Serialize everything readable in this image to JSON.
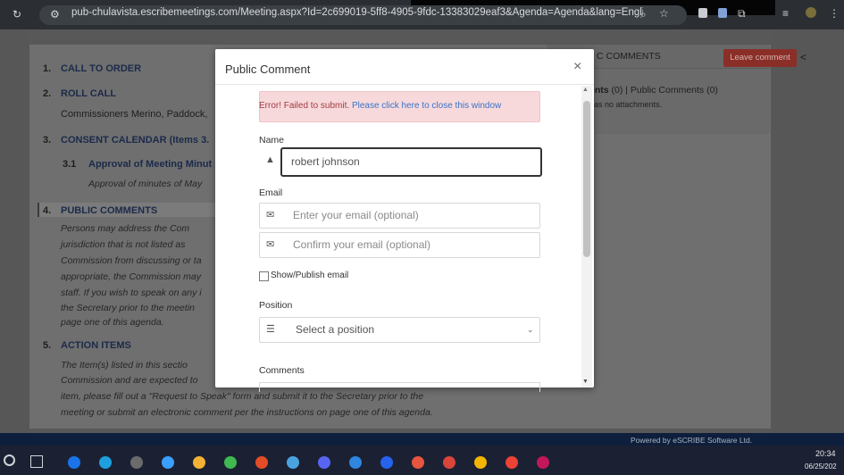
{
  "browser": {
    "url": "pub-chulavista.escribemeetings.com/Meeting.aspx?Id=2c699019-5ff8-4905-9fdc-13383029eaf3&Agenda=Agenda&lang=Englis...",
    "icons": [
      "reload-icon",
      "site-settings-icon",
      "zoom-icon",
      "star-icon",
      "extension-icon",
      "puzzle-icon",
      "reading-list-icon",
      "profile-icon",
      "menu-icon"
    ]
  },
  "agenda": {
    "items": [
      {
        "num": "1.",
        "label": "CALL TO ORDER"
      },
      {
        "num": "2.",
        "label": "ROLL CALL"
      },
      {
        "num": "",
        "label": "Commissioners Merino, Paddock,"
      },
      {
        "num": "3.",
        "label": "CONSENT CALENDAR (Items 3."
      },
      {
        "num": "3.1",
        "label": "Approval of Meeting Minut"
      },
      {
        "num": "",
        "label": "Approval of minutes of May"
      },
      {
        "num": "4.",
        "label": "PUBLIC COMMENTS"
      },
      {
        "num": "5.",
        "label": "ACTION ITEMS"
      }
    ],
    "public_comments_text": [
      "Persons may address the Com",
      "jurisdiction that is not listed as",
      "Commission from discussing or ta",
      "appropriate, the Commission may",
      "staff. If you wish to speak on any i",
      "the Secretary prior to the meetin",
      "page one of this agenda."
    ],
    "action_items_text": [
      "The Item(s) listed in this sectio",
      "Commission and are expected to",
      "item, please fill out a \"Request to Speak\" form and submit it to the Secretary prior to the",
      "meeting  or submit an electronic comment per the instructions on page one of this agenda."
    ]
  },
  "comments_panel": {
    "title": "C COMMENTS",
    "leave_button": "Leave comment",
    "line1_bold": "ents",
    "line1_rest": " (0) | Public Comments (0)",
    "line2": "has no attachments."
  },
  "modal": {
    "title": "Public Comment",
    "close": "×",
    "error_text": "Error! Failed to submit.",
    "error_link": "Please click here to close this window",
    "name_label": "Name",
    "name_value": "robert johnson",
    "email_label": "Email",
    "email_placeholder": "Enter your email (optional)",
    "confirm_placeholder": "Confirm your email (optional)",
    "show_publish_label": "Show/Publish email",
    "position_label": "Position",
    "position_value": "Select a position",
    "comments_label": "Comments"
  },
  "footer": {
    "powered_by": "Powered by eSCRIBE Software Ltd."
  },
  "taskbar": {
    "time": "20:34",
    "date": "06/25/202",
    "app_colors": [
      "#1a73e8",
      "#1f9fe0",
      "#6b6b6b",
      "#3aa0ff",
      "#f2b233",
      "#3fb950",
      "#e34c26",
      "#4aa3df",
      "#5865f2",
      "#2e86de",
      "#2563eb",
      "#e8553e",
      "#d9453b",
      "#f4b400",
      "#ea4335",
      "#c2185b"
    ]
  }
}
